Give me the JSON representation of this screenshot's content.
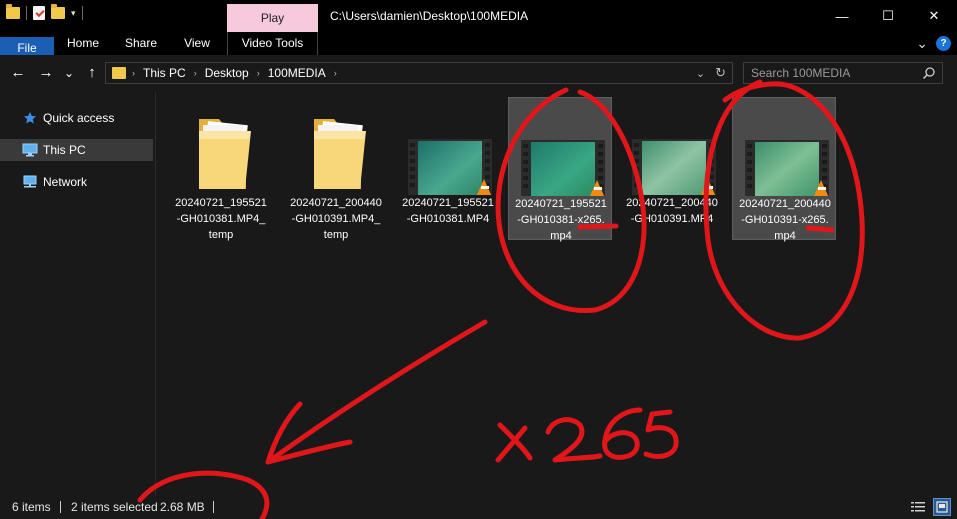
{
  "window": {
    "title": "C:\\Users\\damien\\Desktop\\100MEDIA",
    "context_tab": "Play",
    "controls": {
      "minimize": "—",
      "maximize": "☐",
      "close": "✕"
    }
  },
  "ribbon": {
    "tabs": [
      "File",
      "Home",
      "Share",
      "View",
      "Video Tools"
    ],
    "collapse_glyph": "⌄",
    "help_glyph": "?"
  },
  "nav": {
    "back": "←",
    "forward": "→",
    "recent": "⌄",
    "up": "↑",
    "breadcrumb": [
      "This PC",
      "Desktop",
      "100MEDIA"
    ],
    "dropdown_glyph": "⌄",
    "refresh_glyph": "↻"
  },
  "search": {
    "placeholder": "Search 100MEDIA",
    "value": ""
  },
  "sidebar": {
    "items": [
      {
        "label": "Quick access",
        "icon": "star-icon",
        "selected": false
      },
      {
        "label": "This PC",
        "icon": "monitor-icon",
        "selected": true
      },
      {
        "label": "Network",
        "icon": "network-icon",
        "selected": false
      }
    ]
  },
  "files": [
    {
      "name": "20240721_195521-GH010381.MP4_temp",
      "lines": [
        "20240721_195521",
        "-GH010381.MP4_",
        "temp"
      ],
      "type": "folder",
      "selected": false
    },
    {
      "name": "20240721_200440-GH010391.MP4_temp",
      "lines": [
        "20240721_200440",
        "-GH010391.MP4_",
        "temp"
      ],
      "type": "folder",
      "selected": false
    },
    {
      "name": "20240721_195521-GH010381.MP4",
      "lines": [
        "20240721_195521",
        "-GH010381.MP4"
      ],
      "type": "video",
      "selected": false
    },
    {
      "name": "20240721_195521-GH010381-x265.mp4",
      "lines": [
        "20240721_195521",
        "-GH010381-x265.",
        "mp4"
      ],
      "type": "video",
      "selected": true
    },
    {
      "name": "20240721_200440-GH010391.MP4",
      "lines": [
        "20240721_200440",
        "-GH010391.MP4"
      ],
      "type": "video",
      "selected": false
    },
    {
      "name": "20240721_200440-GH010391-x265.mp4",
      "lines": [
        "20240721_200440",
        "-GH010391-x265.",
        "mp4"
      ],
      "type": "video",
      "selected": true
    }
  ],
  "status": {
    "item_count": "6 items",
    "selection": "2 items selected",
    "size": "2.68 MB"
  },
  "annotation": {
    "text": "x265",
    "color": "#e0161b"
  },
  "colors": {
    "accent": "#1a5fb4",
    "context_tab": "#f7c9dd",
    "folder": "#f0c94c",
    "vlc_cone": "#f08a12"
  }
}
